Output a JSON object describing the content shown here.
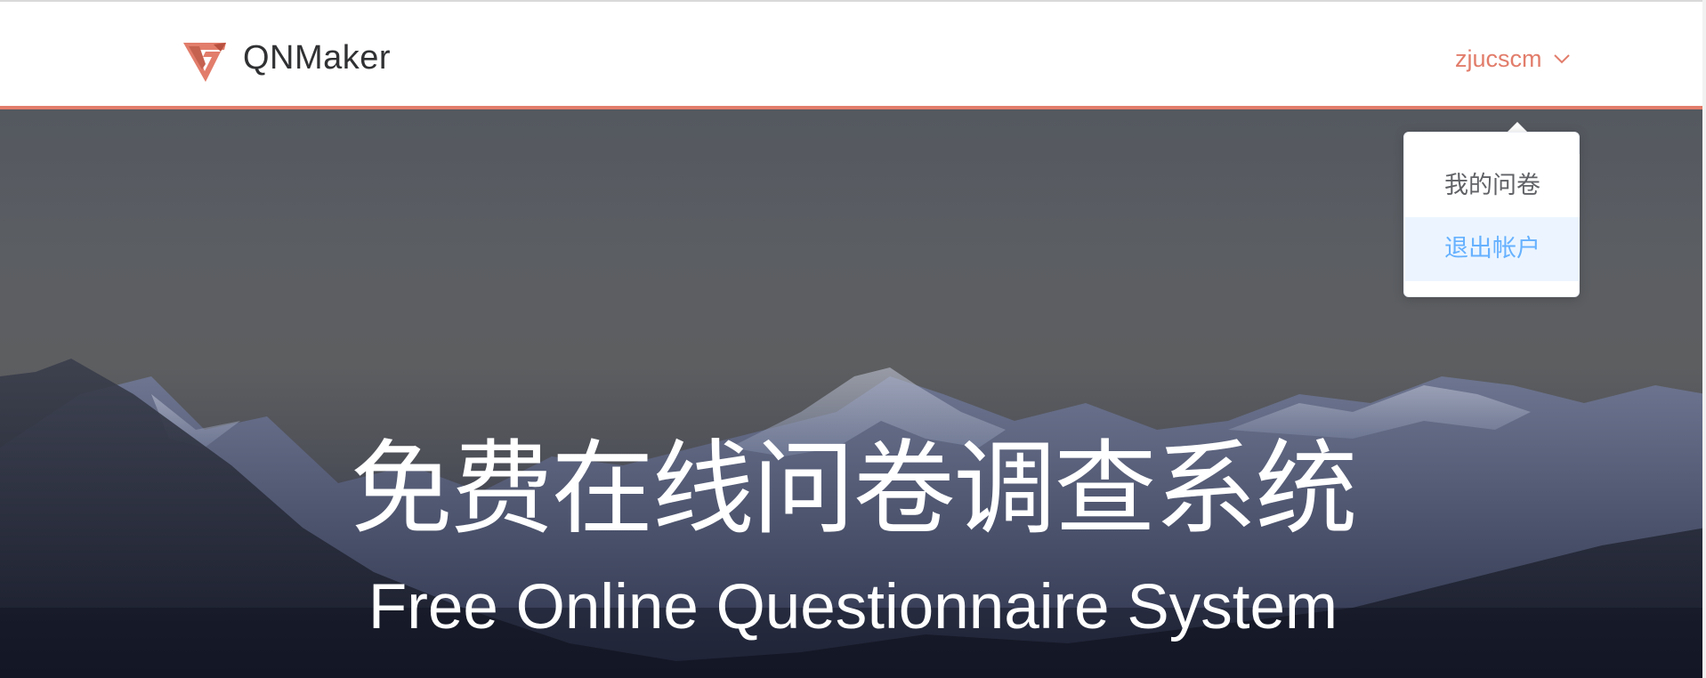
{
  "header": {
    "brand": "QNMaker",
    "logo_icon": "qnmaker-logo-icon",
    "user_name": "zjucscm",
    "accent_color": "#e27d6b"
  },
  "user_dropdown": {
    "items": [
      {
        "label": "我的问卷",
        "state": "default"
      },
      {
        "label": "退出帐户",
        "state": "hovered"
      }
    ],
    "hover_text_color": "#66b1ff",
    "hover_background": "#ecf5ff"
  },
  "hero": {
    "title": "免费在线问卷调查系统",
    "subtitle": "Free Online Questionnaire System"
  }
}
